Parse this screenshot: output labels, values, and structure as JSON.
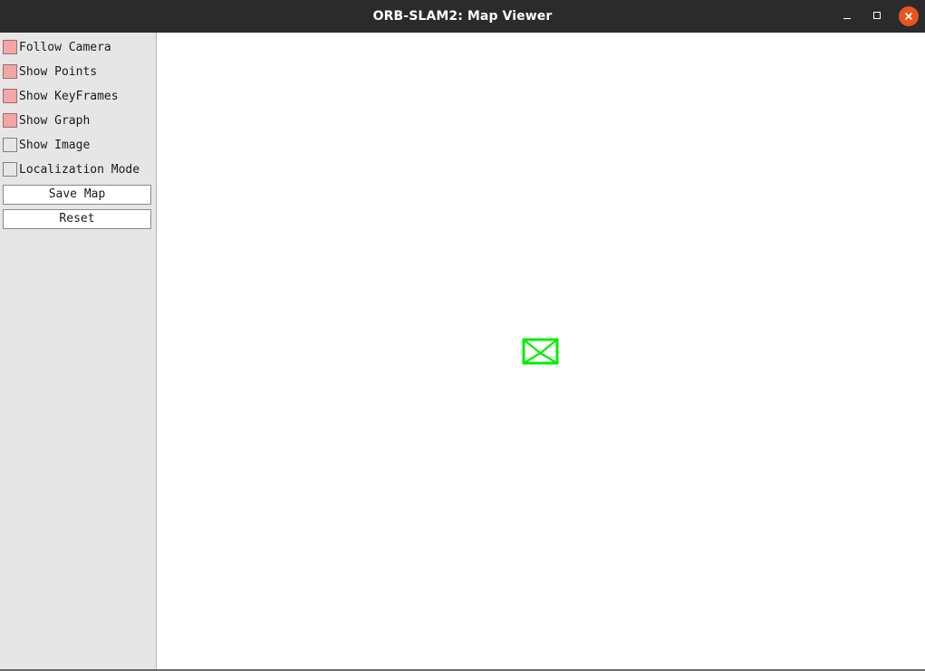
{
  "window": {
    "title": "ORB-SLAM2: Map Viewer"
  },
  "panel": {
    "checkboxes": [
      {
        "label": "Follow Camera",
        "checked": true
      },
      {
        "label": "Show Points",
        "checked": true
      },
      {
        "label": "Show KeyFrames",
        "checked": true
      },
      {
        "label": "Show Graph",
        "checked": true
      },
      {
        "label": "Show Image",
        "checked": false
      },
      {
        "label": "Localization Mode",
        "checked": false
      }
    ],
    "buttons": [
      {
        "label": "Save Map"
      },
      {
        "label": "Reset"
      }
    ]
  },
  "colors": {
    "titlebar": "#2b2b2b",
    "close_button": "#e95420",
    "checkbox_on": "#f4a5a5",
    "panel_bg": "#e6e6e6",
    "camera": "#00ee00"
  },
  "icons": {
    "minimize": "minimize-icon",
    "maximize": "maximize-icon",
    "close": "close-icon",
    "camera": "camera-frustum-icon"
  }
}
